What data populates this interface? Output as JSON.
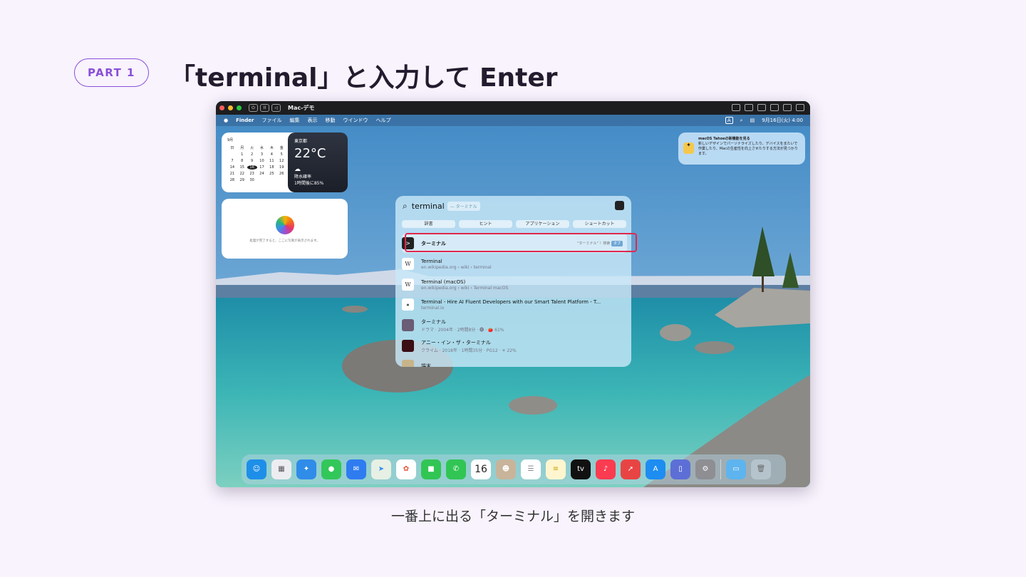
{
  "header": {
    "badge": "PART 1",
    "title": "「terminal」と入力して Enter"
  },
  "caption": "一番上に出る「ターミナル」を開きます",
  "window": {
    "title": "Mac-デモ",
    "menubar": {
      "items": [
        "Finder",
        "ファイル",
        "編集",
        "表示",
        "移動",
        "ウインドウ",
        "ヘルプ"
      ],
      "input_indicator": "A",
      "datetime": "9月16日(火) 4:00"
    },
    "calendar": {
      "month": "9月",
      "weekdays": [
        "日",
        "月",
        "火",
        "水",
        "木",
        "金",
        "土"
      ],
      "days": [
        "",
        "1",
        "2",
        "3",
        "4",
        "5",
        "6",
        "7",
        "8",
        "9",
        "10",
        "11",
        "12",
        "13",
        "14",
        "15",
        "16",
        "17",
        "18",
        "19",
        "20",
        "21",
        "22",
        "23",
        "24",
        "25",
        "26",
        "27",
        "28",
        "29",
        "30",
        "",
        "",
        ""
      ],
      "today": "16"
    },
    "weather": {
      "city": "東京都",
      "temp": "22°C",
      "line1": "降水確率",
      "line2": "1時間後に85%"
    },
    "photos_widget_text": "処理が完了すると、ここに写真が表示されます。",
    "tip": {
      "title": "macOS Tahoeの新機能を見る",
      "body": "新しいデザインでパーソナライズしたり、デバイスをまたいで作業したり、Macの生産性を向上させたりする方法が見つかります。"
    },
    "spotlight": {
      "query": "terminal",
      "completion": "— ターミナル",
      "categories": [
        "辞書",
        "ヒント",
        "アプリケーション",
        "ショートカット"
      ],
      "results": [
        {
          "title": "ターミナル",
          "subtitle": "",
          "hint": "\"ターミナル\" 〉検索",
          "key": "タブ"
        },
        {
          "title": "Terminal",
          "subtitle": "en.wikipedia.org › wiki › terminal"
        },
        {
          "title": "Terminal (macOS)",
          "subtitle": "en.wikipedia.org › wiki › Terminal macOS"
        },
        {
          "title": "Terminal - Hire AI Fluent Developers with our Smart Talent Platform - T...",
          "subtitle": "terminal.io"
        },
        {
          "title": "ターミナル",
          "subtitle": "ドラマ · 2004年 · 2時間8分 · 🅖 · 🍅 61%"
        },
        {
          "title": "アニー・イン・ザ・ターミナル",
          "subtitle": "クライム · 2018年 · 1時間35分 · PG12 · ✳ 22%"
        },
        {
          "title": "端末",
          "subtitle": ""
        }
      ]
    },
    "dock": {
      "apps": [
        "Finder",
        "Launchpad",
        "Safari",
        "Messages",
        "Mail",
        "Maps",
        "Photos",
        "FaceTime",
        "Phone",
        "Calendar",
        "Contacts",
        "Reminders",
        "Notes",
        "TV",
        "Music",
        "Rocket",
        "App Store",
        "iPhone Mirroring",
        "System Settings",
        "Downloads",
        "Trash"
      ],
      "calendar_day": "16"
    }
  }
}
